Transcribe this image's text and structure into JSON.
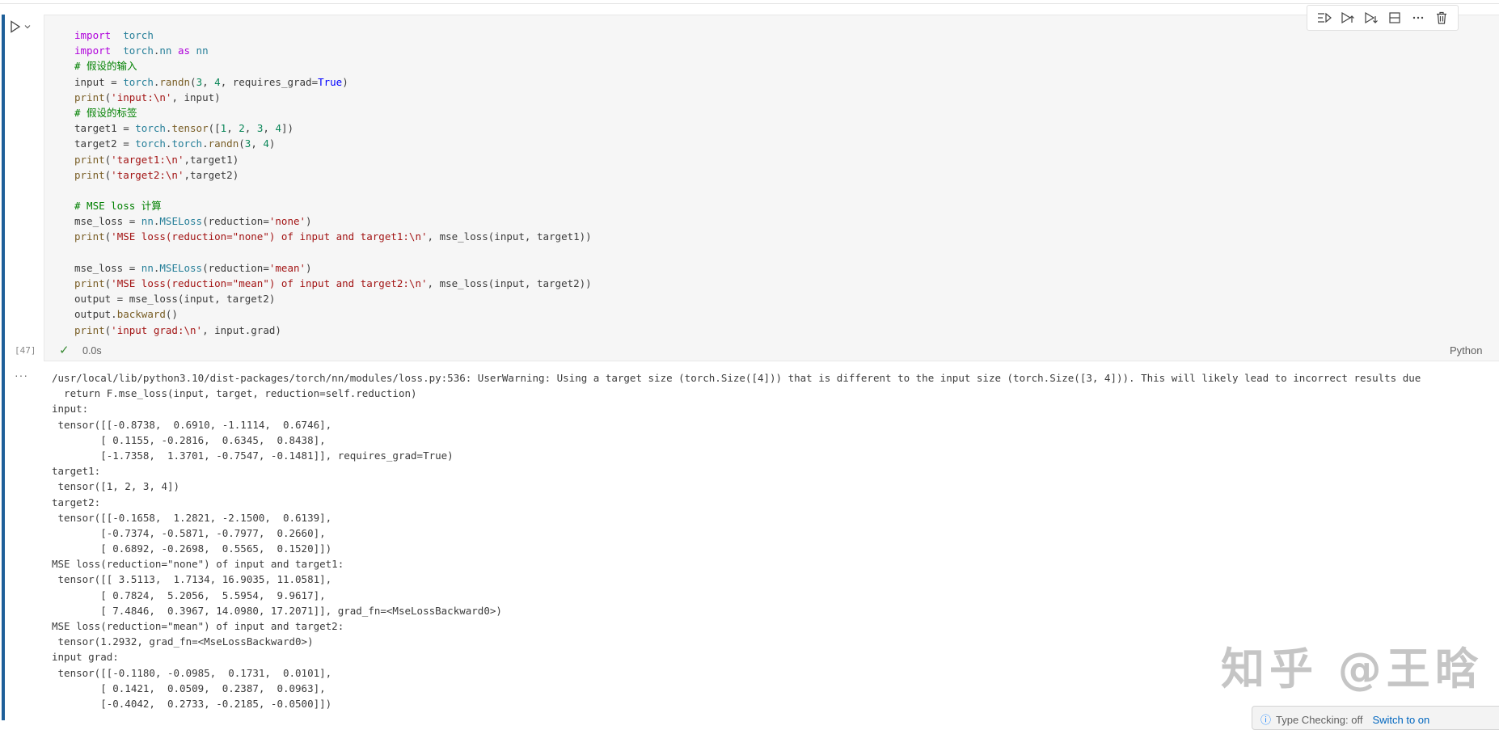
{
  "cell": {
    "execution_count": "[47]",
    "exec_time": "0.0s",
    "language": "Python",
    "code_lines": [
      [
        [
          "kw",
          "import"
        ],
        [
          "",
          "  "
        ],
        [
          "mod",
          "torch"
        ]
      ],
      [
        [
          "kw",
          "import"
        ],
        [
          "",
          "  "
        ],
        [
          "mod",
          "torch"
        ],
        [
          "",
          "."
        ],
        [
          "mod",
          "nn"
        ],
        [
          "",
          ""
        ],
        [
          "kw",
          " as"
        ],
        [
          "",
          ""
        ],
        [
          "mod",
          " nn"
        ]
      ],
      [
        [
          "cmt",
          "# 假设的输入"
        ]
      ],
      [
        [
          "",
          "input = "
        ],
        [
          "mod",
          "torch"
        ],
        [
          "",
          "."
        ],
        [
          "fn",
          "randn"
        ],
        [
          "",
          "("
        ],
        [
          "num",
          "3"
        ],
        [
          "",
          ", "
        ],
        [
          "num",
          "4"
        ],
        [
          "",
          ", requires_grad="
        ],
        [
          "kwb",
          "True"
        ],
        [
          "",
          ")"
        ]
      ],
      [
        [
          "fn",
          "print"
        ],
        [
          "",
          "("
        ],
        [
          "str",
          "'input:\\n'"
        ],
        [
          "",
          ", input)"
        ]
      ],
      [
        [
          "cmt",
          "# 假设的标签"
        ]
      ],
      [
        [
          "",
          "target1 = "
        ],
        [
          "mod",
          "torch"
        ],
        [
          "",
          "."
        ],
        [
          "fn",
          "tensor"
        ],
        [
          "",
          "(["
        ],
        [
          "num",
          "1"
        ],
        [
          "",
          ", "
        ],
        [
          "num",
          "2"
        ],
        [
          "",
          ", "
        ],
        [
          "num",
          "3"
        ],
        [
          "",
          ", "
        ],
        [
          "num",
          "4"
        ],
        [
          "",
          "])"
        ]
      ],
      [
        [
          "",
          "target2 = "
        ],
        [
          "mod",
          "torch"
        ],
        [
          "",
          "."
        ],
        [
          "mod",
          "torch"
        ],
        [
          "",
          "."
        ],
        [
          "fn",
          "randn"
        ],
        [
          "",
          "("
        ],
        [
          "num",
          "3"
        ],
        [
          "",
          ", "
        ],
        [
          "num",
          "4"
        ],
        [
          "",
          ")"
        ]
      ],
      [
        [
          "fn",
          "print"
        ],
        [
          "",
          "("
        ],
        [
          "str",
          "'target1:\\n'"
        ],
        [
          "",
          ",target1)"
        ]
      ],
      [
        [
          "fn",
          "print"
        ],
        [
          "",
          "("
        ],
        [
          "str",
          "'target2:\\n'"
        ],
        [
          "",
          ",target2)"
        ]
      ],
      [
        [
          "",
          ""
        ]
      ],
      [
        [
          "cmt",
          "# MSE loss 计算"
        ]
      ],
      [
        [
          "",
          "mse_loss = "
        ],
        [
          "mod",
          "nn"
        ],
        [
          "",
          "."
        ],
        [
          "mod",
          "MSELoss"
        ],
        [
          "",
          "(reduction="
        ],
        [
          "str",
          "'none'"
        ],
        [
          "",
          ")"
        ]
      ],
      [
        [
          "fn",
          "print"
        ],
        [
          "",
          "("
        ],
        [
          "str",
          "'MSE loss(reduction=\"none\") of input and target1:\\n'"
        ],
        [
          "",
          ", mse_loss(input, target1))"
        ]
      ],
      [
        [
          "",
          ""
        ]
      ],
      [
        [
          "",
          "mse_loss = "
        ],
        [
          "mod",
          "nn"
        ],
        [
          "",
          "."
        ],
        [
          "mod",
          "MSELoss"
        ],
        [
          "",
          "(reduction="
        ],
        [
          "str",
          "'mean'"
        ],
        [
          "",
          ")"
        ]
      ],
      [
        [
          "fn",
          "print"
        ],
        [
          "",
          "("
        ],
        [
          "str",
          "'MSE loss(reduction=\"mean\") of input and target2:\\n'"
        ],
        [
          "",
          ", mse_loss(input, target2))"
        ]
      ],
      [
        [
          "",
          "output = mse_loss(input, target2)"
        ]
      ],
      [
        [
          "",
          "output."
        ],
        [
          "fn",
          "backward"
        ],
        [
          "",
          "()"
        ]
      ],
      [
        [
          "fn",
          "print"
        ],
        [
          "",
          "("
        ],
        [
          "str",
          "'input grad:\\n'"
        ],
        [
          "",
          ", input.grad)"
        ]
      ]
    ]
  },
  "output_lines": [
    "/usr/local/lib/python3.10/dist-packages/torch/nn/modules/loss.py:536: UserWarning: Using a target size (torch.Size([4])) that is different to the input size (torch.Size([3, 4])). This will likely lead to incorrect results due",
    "  return F.mse_loss(input, target, reduction=self.reduction)",
    "input:",
    " tensor([[-0.8738,  0.6910, -1.1114,  0.6746],",
    "        [ 0.1155, -0.2816,  0.6345,  0.8438],",
    "        [-1.7358,  1.3701, -0.7547, -0.1481]], requires_grad=True)",
    "target1:",
    " tensor([1, 2, 3, 4])",
    "target2:",
    " tensor([[-0.1658,  1.2821, -2.1500,  0.6139],",
    "        [-0.7374, -0.5871, -0.7977,  0.2660],",
    "        [ 0.6892, -0.2698,  0.5565,  0.1520]])",
    "MSE loss(reduction=\"none\") of input and target1:",
    " tensor([[ 3.5113,  1.7134, 16.9035, 11.0581],",
    "        [ 0.7824,  5.2056,  5.5954,  9.9617],",
    "        [ 7.4846,  0.3967, 14.0980, 17.2071]], grad_fn=<MseLossBackward0>)",
    "MSE loss(reduction=\"mean\") of input and target2:",
    " tensor(1.2932, grad_fn=<MseLossBackward0>)",
    "input grad:",
    " tensor([[-0.1180, -0.0985,  0.1731,  0.0101],",
    "        [ 0.1421,  0.0509,  0.2387,  0.0963],",
    "        [-0.4042,  0.2733, -0.2185, -0.0500]])"
  ],
  "toolbar": {
    "icons": [
      "run-by-line-icon",
      "execute-above-icon",
      "execute-below-icon",
      "split-cell-icon",
      "more-actions-icon",
      "delete-icon"
    ]
  },
  "watermark": "知乎 @王晗",
  "type_checking": {
    "label": "Type Checking: off",
    "action": "Switch to on"
  }
}
